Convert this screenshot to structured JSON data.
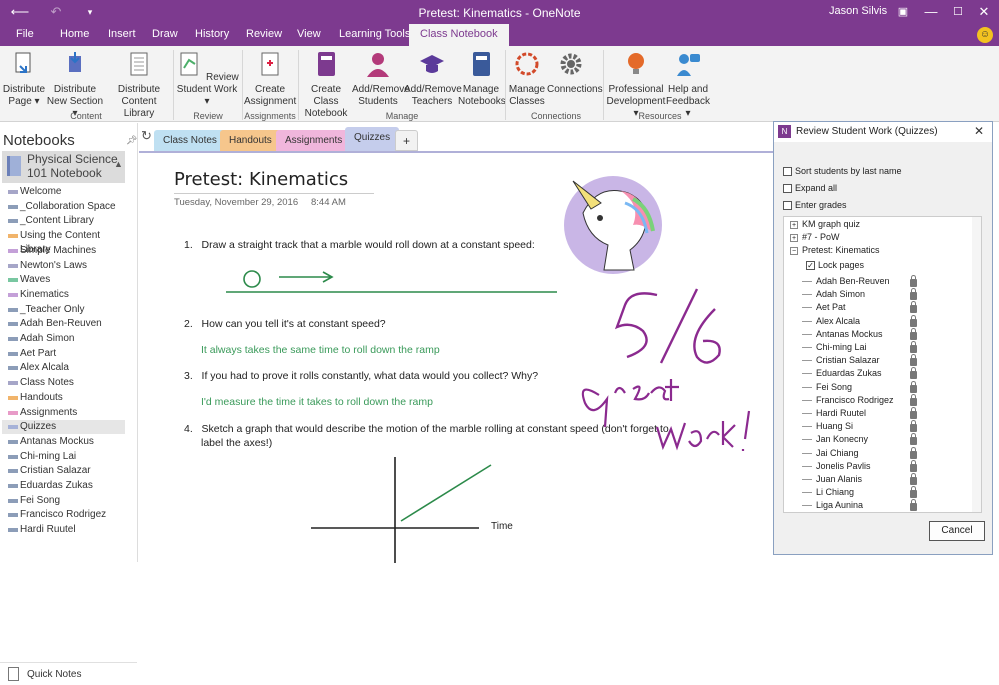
{
  "window": {
    "title": "Pretest: Kinematics - OneNote",
    "user": "Jason Silvis"
  },
  "ribbon_tabs": [
    "File",
    "Home",
    "Insert",
    "Draw",
    "History",
    "Review",
    "View",
    "Learning Tools",
    "Class Notebook"
  ],
  "ribbon": {
    "buttons": [
      {
        "label": "Distribute Page ▾"
      },
      {
        "label": "Distribute New Section ▾"
      },
      {
        "label": "Distribute Content Library"
      },
      {
        "label": "Review Student Work ▾"
      },
      {
        "label": "Create Assignment"
      },
      {
        "label": "Create Class Notebook"
      },
      {
        "label": "Add/Remove Students"
      },
      {
        "label": "Add/Remove Teachers"
      },
      {
        "label": "Manage Notebooks"
      },
      {
        "label": "Manage Classes"
      },
      {
        "label": "Connections"
      },
      {
        "label": "Professional Development ▾"
      },
      {
        "label": "Help and Feedback ▾"
      }
    ],
    "groups": [
      "Content",
      "Review",
      "Assignments",
      "Manage",
      "Connections",
      "Resources"
    ]
  },
  "notebooks": {
    "header": "Notebooks",
    "current": "Physical Science 101 Notebook",
    "sections": [
      {
        "label": "Welcome",
        "color": "#a6a6c8"
      },
      {
        "label": "_Collaboration Space",
        "color": "#8c9db8"
      },
      {
        "label": "_Content Library",
        "color": "#8c9db8"
      },
      {
        "label": "Using the Content Library",
        "color": "#f1b46b"
      },
      {
        "label": "Simple Machines",
        "color": "#c4a0d8"
      },
      {
        "label": "Newton's Laws",
        "color": "#a6a6c8"
      },
      {
        "label": "Waves",
        "color": "#79c7a1"
      },
      {
        "label": "Kinematics",
        "color": "#c4a0d8"
      },
      {
        "label": "_Teacher Only",
        "color": "#8c9db8"
      },
      {
        "label": "Adah Ben-Reuven",
        "color": "#8c9db8"
      },
      {
        "label": "Adah Simon",
        "color": "#8c9db8"
      },
      {
        "label": "Aet Part",
        "color": "#8c9db8"
      },
      {
        "label": "Alex Alcala",
        "color": "#8c9db8"
      },
      {
        "label": "Class Notes",
        "color": "#a6a6c8"
      },
      {
        "label": "Handouts",
        "color": "#f1b46b"
      },
      {
        "label": "Assignments",
        "color": "#e89bc8"
      },
      {
        "label": "Quizzes",
        "color": "#a6b2d8"
      },
      {
        "label": "Antanas Mockus",
        "color": "#8c9db8"
      },
      {
        "label": "Chi-ming Lai",
        "color": "#8c9db8"
      },
      {
        "label": "Cristian Salazar",
        "color": "#8c9db8"
      },
      {
        "label": "Eduardas Zukas",
        "color": "#8c9db8"
      },
      {
        "label": "Fei Song",
        "color": "#8c9db8"
      },
      {
        "label": "Francisco Rodrigez",
        "color": "#8c9db8"
      },
      {
        "label": "Hardi Ruutel",
        "color": "#8c9db8"
      }
    ],
    "quick_notes": "Quick Notes"
  },
  "page_tabs": [
    {
      "label": "Class Notes",
      "color": "#bfe0f2"
    },
    {
      "label": "Handouts",
      "color": "#f6c68c"
    },
    {
      "label": "Assignments",
      "color": "#f0b6dc"
    },
    {
      "label": "Quizzes",
      "color": "#c5cdec"
    }
  ],
  "page": {
    "title": "Pretest: Kinematics",
    "date": "Tuesday, November 29, 2016",
    "time": "8:44 AM",
    "questions": [
      {
        "num": "1.",
        "text": "Draw a straight track that a marble would roll down at a constant speed:"
      },
      {
        "num": "2.",
        "text": "How can you tell it's at constant speed?"
      },
      {
        "num": "3.",
        "text": "If you had to prove it rolls constantly, what data would you collect? Why?"
      },
      {
        "num": "4.",
        "text": "Sketch a graph that would describe the motion of the marble rolling at constant speed (don't forget to"
      },
      {
        "num": "",
        "text": "label the axes!)"
      }
    ],
    "answers": [
      "It always takes the same time to roll down the ramp",
      "I'd measure the time it takes to roll down the ramp"
    ],
    "graph_xlabel": "Time",
    "handwriting": {
      "grade": "5/6",
      "comment_line1": "Great",
      "comment_line2": "work!"
    }
  },
  "panel": {
    "title": "Review Student Work (Quizzes)",
    "options": [
      "Sort students by last name",
      "Expand all",
      "Enter grades"
    ],
    "tree": [
      "KM graph quiz",
      "#7 - PoW",
      "Pretest: Kinematics"
    ],
    "lock_pages": "Lock pages",
    "students": [
      "Adah Ben-Reuven",
      "Adah Simon",
      "Aet Pat",
      "Alex Alcala",
      "Antanas Mockus",
      "Chi-ming Lai",
      "Cristian Salazar",
      "Eduardas Zukas",
      "Fei Song",
      "Francisco Rodrigez",
      "Hardi Ruutel",
      "Huang Si",
      "Jan Konecny",
      "Jai Chiang",
      "Jonelis Pavlis",
      "Juan Alanis",
      "Li Chiang",
      "Liga Aunina"
    ],
    "cancel": "Cancel"
  },
  "colors": {
    "accent": "#7d3a8f",
    "answer_green": "#3a9a5a",
    "ink_purple": "#8b2a8f"
  }
}
